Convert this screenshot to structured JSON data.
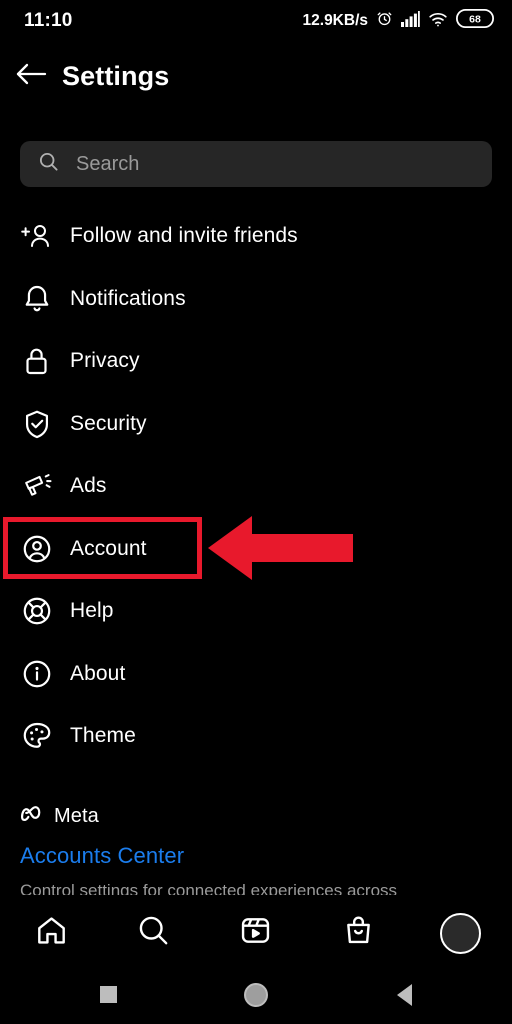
{
  "status_bar": {
    "clock": "11:10",
    "network_speed": "12.9KB/s",
    "alarm_icon": "alarm-clock-icon",
    "signal_icon": "cellular-signal-icon",
    "wifi_icon": "wifi-icon",
    "battery_level": "68"
  },
  "header": {
    "back_icon": "back-arrow-icon",
    "title": "Settings"
  },
  "search": {
    "icon": "search-icon",
    "placeholder": "Search",
    "value": ""
  },
  "menu": {
    "items": [
      {
        "label": "Follow and invite friends",
        "icon": "add-person-icon"
      },
      {
        "label": "Notifications",
        "icon": "bell-icon"
      },
      {
        "label": "Privacy",
        "icon": "lock-icon"
      },
      {
        "label": "Security",
        "icon": "shield-check-icon"
      },
      {
        "label": "Ads",
        "icon": "megaphone-icon"
      },
      {
        "label": "Account",
        "icon": "account-circle-icon"
      },
      {
        "label": "Help",
        "icon": "life-ring-icon"
      },
      {
        "label": "About",
        "icon": "info-circle-icon"
      },
      {
        "label": "Theme",
        "icon": "palette-icon"
      }
    ]
  },
  "annotation": {
    "highlight_color": "#e8192c",
    "highlighted_item": "Account",
    "arrow_icon": "left-pointing-arrow-icon"
  },
  "meta_section": {
    "logo_icon": "meta-infinity-logo-icon",
    "brand": "Meta",
    "link": "Accounts Center",
    "link_color": "#1b7ded",
    "description": "Control settings for connected experiences across"
  },
  "bottom_nav": {
    "items": [
      {
        "name": "home",
        "icon": "home-icon"
      },
      {
        "name": "search",
        "icon": "search-icon"
      },
      {
        "name": "reels",
        "icon": "reels-play-icon"
      },
      {
        "name": "shop",
        "icon": "shopping-bag-icon"
      },
      {
        "name": "profile",
        "icon": "avatar-icon"
      }
    ]
  },
  "system_nav": {
    "recents_icon": "square-recents-icon",
    "home_icon": "circle-home-icon",
    "back_icon": "triangle-back-icon"
  }
}
